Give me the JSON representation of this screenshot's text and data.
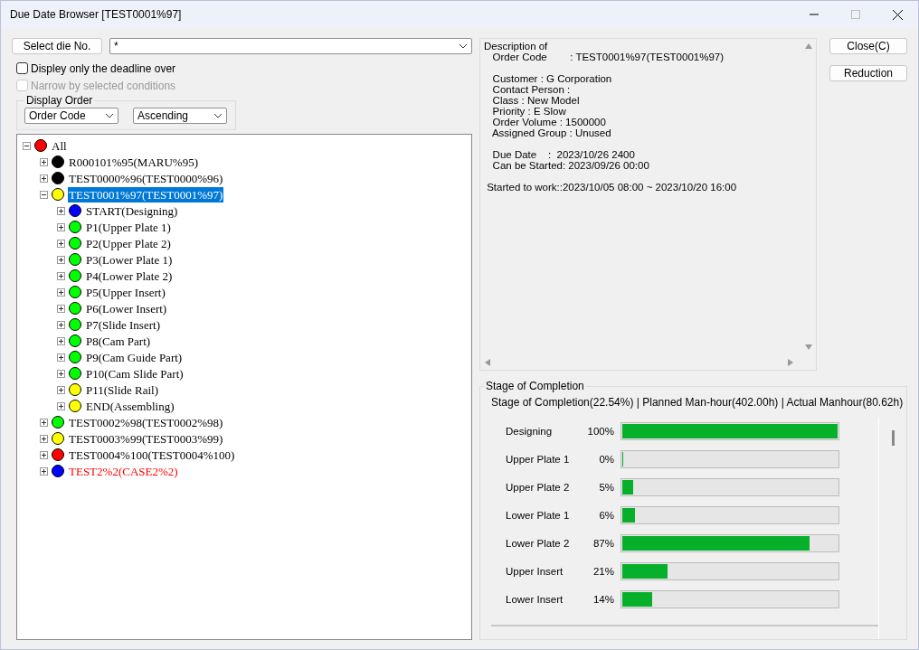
{
  "window": {
    "title": "Due Date Browser [TEST0001%97]"
  },
  "select_button": "Select die No.",
  "die_field": {
    "value": "*"
  },
  "checkboxes": [
    {
      "label": "Displey only the deadline over",
      "checked": false,
      "disabled": false
    },
    {
      "label": "Narrow by selected conditions",
      "checked": false,
      "disabled": true
    }
  ],
  "display_order": {
    "title": "Display Order",
    "sort_field": "Order Code",
    "direction": "Ascending"
  },
  "tree": [
    {
      "label": "All",
      "color": "#ff0000",
      "expanded": true,
      "selected": false,
      "overdue": false,
      "children": [
        {
          "label": "R000101%95(MARU%95)",
          "color": "#000000",
          "expanded": false,
          "selected": false,
          "overdue": false
        },
        {
          "label": "TEST0000%96(TEST0000%96)",
          "color": "#000000",
          "expanded": false,
          "selected": false,
          "overdue": false
        },
        {
          "label": "TEST0001%97(TEST0001%97)",
          "color": "#ffff00",
          "expanded": true,
          "selected": true,
          "overdue": false,
          "children": [
            {
              "label": "START(Designing)",
              "color": "#0000ff",
              "expanded": false,
              "selected": false,
              "overdue": false
            },
            {
              "label": "P1(Upper Plate 1)",
              "color": "#00ff00",
              "expanded": false,
              "selected": false,
              "overdue": false
            },
            {
              "label": "P2(Upper Plate 2)",
              "color": "#00ff00",
              "expanded": false,
              "selected": false,
              "overdue": false
            },
            {
              "label": "P3(Lower Plate 1)",
              "color": "#00ff00",
              "expanded": false,
              "selected": false,
              "overdue": false
            },
            {
              "label": "P4(Lower Plate 2)",
              "color": "#00ff00",
              "expanded": false,
              "selected": false,
              "overdue": false
            },
            {
              "label": "P5(Upper Insert)",
              "color": "#00ff00",
              "expanded": false,
              "selected": false,
              "overdue": false
            },
            {
              "label": "P6(Lower Insert)",
              "color": "#00ff00",
              "expanded": false,
              "selected": false,
              "overdue": false
            },
            {
              "label": "P7(Slide Insert)",
              "color": "#00ff00",
              "expanded": false,
              "selected": false,
              "overdue": false
            },
            {
              "label": "P8(Cam Part)",
              "color": "#00ff00",
              "expanded": false,
              "selected": false,
              "overdue": false
            },
            {
              "label": "P9(Cam Guide Part)",
              "color": "#00ff00",
              "expanded": false,
              "selected": false,
              "overdue": false
            },
            {
              "label": "P10(Cam Slide Part)",
              "color": "#00ff00",
              "expanded": false,
              "selected": false,
              "overdue": false
            },
            {
              "label": "P11(Slide Rail)",
              "color": "#ffff00",
              "expanded": false,
              "selected": false,
              "overdue": false
            },
            {
              "label": "END(Assembling)",
              "color": "#ffff00",
              "expanded": false,
              "selected": false,
              "overdue": false
            }
          ]
        },
        {
          "label": "TEST0002%98(TEST0002%98)",
          "color": "#00ff00",
          "expanded": false,
          "selected": false,
          "overdue": false
        },
        {
          "label": "TEST0003%99(TEST0003%99)",
          "color": "#ffff00",
          "expanded": false,
          "selected": false,
          "overdue": false
        },
        {
          "label": "TEST0004%100(TEST0004%100)",
          "color": "#ff0000",
          "expanded": false,
          "selected": false,
          "overdue": false
        },
        {
          "label": "TEST2%2(CASE2%2)",
          "color": "#0000ff",
          "expanded": false,
          "selected": false,
          "overdue": true
        }
      ]
    }
  ],
  "description": {
    "blocks": [
      [
        "Description of",
        "   Order Code        : TEST0001%97(TEST0001%97)"
      ],
      [
        "   Customer : G Corporation",
        "   Contact Person :",
        "   Class : New Model",
        "   Priority : E Slow",
        "   Order Volume : 1500000",
        "   Assigned Group : Unused"
      ],
      [
        "   Due Date    :  2023/10/26 2400",
        "   Can be Started: 2023/09/26 00:00"
      ],
      [
        " Started to work::2023/10/05 08:00 ~ 2023/10/20 16:00"
      ]
    ]
  },
  "buttons": [
    "Close(C)",
    "Reduction"
  ],
  "completion": {
    "title": "Stage of Completion",
    "summary": "Stage of Completion(22.54%) | Planned Man-hour(402.00h) | Actual Manhour(80.62h)",
    "stages": [
      {
        "name": "Designing",
        "reading": "100%",
        "level": 1
      },
      {
        "name": "Upper Plate 1",
        "reading": "0%",
        "level": 0
      },
      {
        "name": "Upper Plate 2",
        "reading": "5%",
        "level": 0.05
      },
      {
        "name": "Lower Plate 1",
        "reading": "6%",
        "level": 0.06
      },
      {
        "name": "Lower Plate 2",
        "reading": "87%",
        "level": 0.87
      },
      {
        "name": "Upper Insert",
        "reading": "21%",
        "level": 0.21
      },
      {
        "name": "Lower Insert",
        "reading": "14%",
        "level": 0.14
      }
    ]
  }
}
